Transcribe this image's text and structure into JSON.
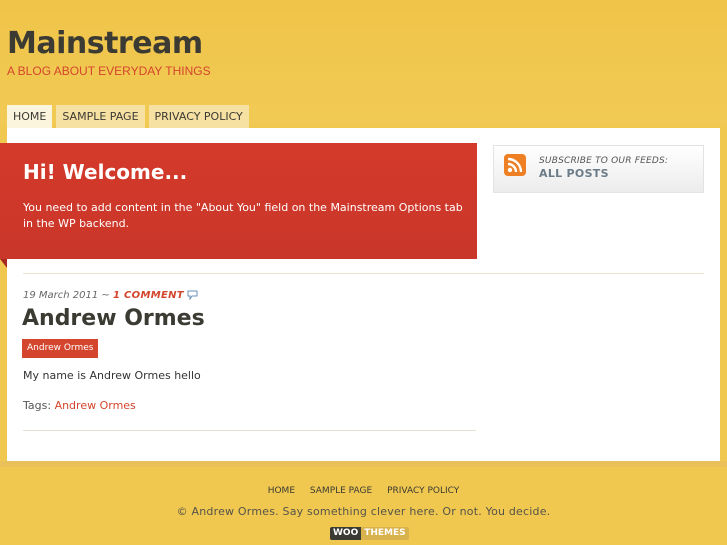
{
  "site": {
    "title": "Mainstream",
    "tagline": "A BLOG ABOUT EVERYDAY THINGS"
  },
  "nav": {
    "items": [
      {
        "label": "HOME",
        "active": true
      },
      {
        "label": "SAMPLE PAGE",
        "active": false
      },
      {
        "label": "PRIVACY POLICY",
        "active": false
      }
    ]
  },
  "welcome": {
    "title": "Hi! Welcome...",
    "text": "You need to add content in the \"About You\" field on the Mainstream Options tab in the WP backend."
  },
  "sidebar": {
    "feed_label": "SUBSCRIBE TO OUR FEEDS:",
    "feed_link": "ALL POSTS"
  },
  "post": {
    "date": "19 March 2011",
    "separator": " ~ ",
    "comments": "1 COMMENT",
    "title": "Andrew Ormes",
    "category": "Andrew Ormes",
    "body": "My name is Andrew Ormes hello",
    "tags_label": "Tags: ",
    "tag": "Andrew Ormes"
  },
  "footer": {
    "nav": [
      "HOME",
      "SAMPLE PAGE",
      "PRIVACY POLICY"
    ],
    "copyright": "© Andrew Ormes. Say something clever here. Or not. You decide.",
    "logo_woo": "WOO",
    "logo_themes": "THEMES"
  },
  "colors": {
    "background": "#f0c850",
    "accent": "#d4452d",
    "text_dark": "#3b3a33"
  }
}
